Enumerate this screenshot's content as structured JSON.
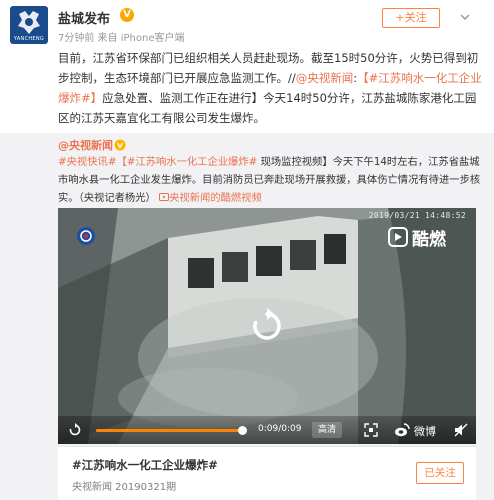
{
  "header": {
    "account_name": "盐城发布",
    "avatar_label": "YANCHENG",
    "verified_mark": "V",
    "meta": "7分钟前 来自 iPhone客户端",
    "follow_label": "+关注"
  },
  "post": {
    "text_part1": "目前，江苏省环保部门已组织相关人员赶赴现场。截至15时50分许，火势已得到初步控制，生态环境部门已开展应急监测工作。//",
    "mention": "@央视新闻",
    "colon": ":",
    "topic": "【#江苏响水一化工企业爆炸#】",
    "text_part2": "应急处置、监测工作正在进行】今天14时50分许，江苏盐城陈家港化工园区的江苏天嘉宜化工有限公司发生爆炸。"
  },
  "repost": {
    "author": "@央视新闻",
    "tag_prefix": "#央视快讯#",
    "topic": "【#江苏响水一化工企业爆炸#",
    "body": "现场监控视频】今天下午14时左右，江苏省盐城市响水县一化工企业发生爆炸。目前消防员已奔赴现场开展救援，具体伤亡情况有待进一步核实。（央视记者杨光）",
    "video_link": "央视新闻的酷燃视频"
  },
  "video": {
    "timestamp": "2019/03/21 14:48:52",
    "watermark": "酷燃",
    "time_display": "0:09/0:09",
    "quality": "高清",
    "weibo": "微博",
    "progress": 1.0
  },
  "topic_card": {
    "title": "#江苏响水一化工企业爆炸#",
    "subtitle": "央视新闻 20190321期",
    "followed_label": "已关注"
  },
  "colors": {
    "accent": "#ff8140",
    "link": "#eb7350",
    "progress": "#ff8200",
    "repost_bg": "#f2f2f5",
    "avatar_bg": "#1a4b8c"
  }
}
